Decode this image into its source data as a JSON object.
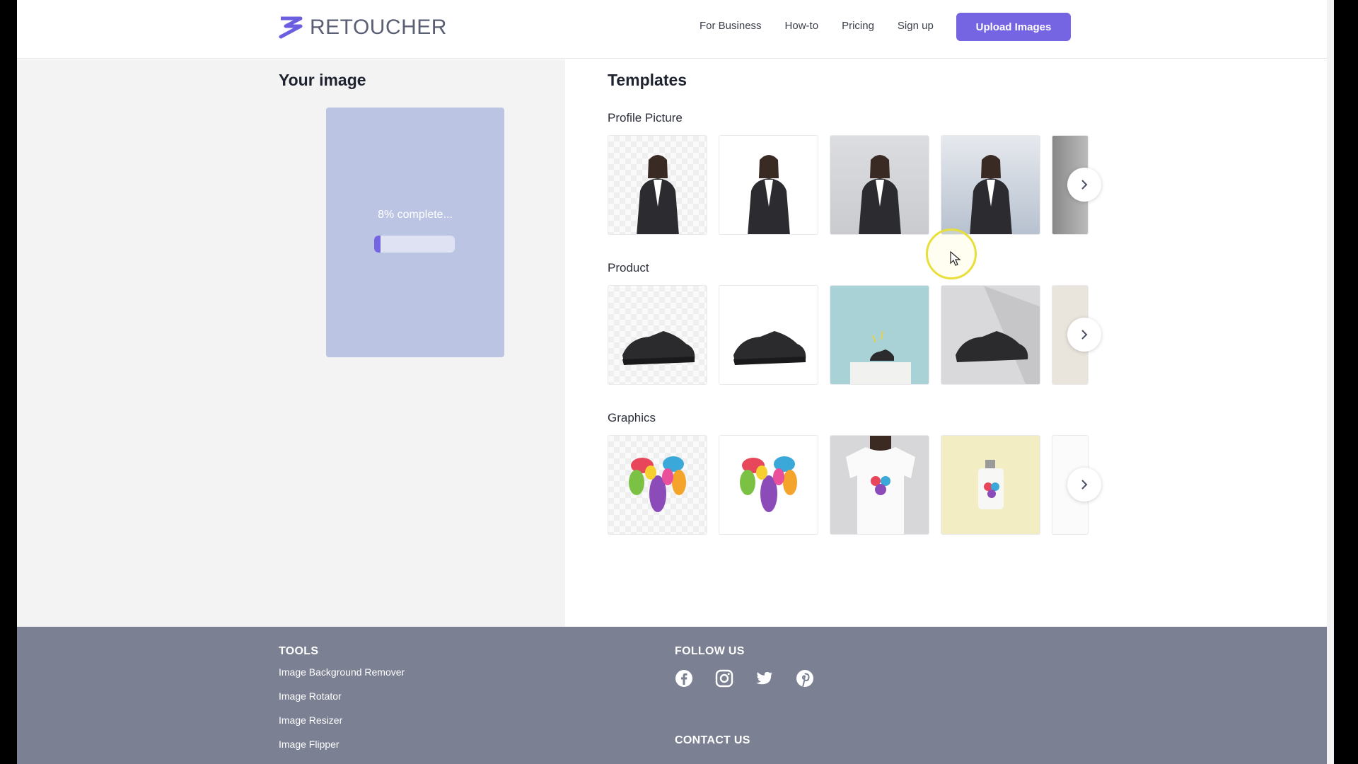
{
  "brand": {
    "name": "RETOUCHER",
    "accent": "#7565e3"
  },
  "nav": {
    "links": [
      "For Business",
      "How-to",
      "Pricing",
      "Sign up"
    ],
    "upload_label": "Upload Images"
  },
  "your_image": {
    "title": "Your image",
    "progress_text": "8% complete...",
    "progress_fraction": 0.08
  },
  "templates": {
    "title": "Templates",
    "sections": [
      {
        "title": "Profile Picture"
      },
      {
        "title": "Product"
      },
      {
        "title": "Graphics"
      }
    ]
  },
  "footer": {
    "tools_title": "TOOLS",
    "tools": [
      "Image Background Remover",
      "Image Rotator",
      "Image Resizer",
      "Image Flipper"
    ],
    "follow_title": "FOLLOW US",
    "social_icons": [
      "facebook-icon",
      "instagram-icon",
      "twitter-icon",
      "pinterest-icon"
    ],
    "contact_title": "CONTACT US"
  }
}
